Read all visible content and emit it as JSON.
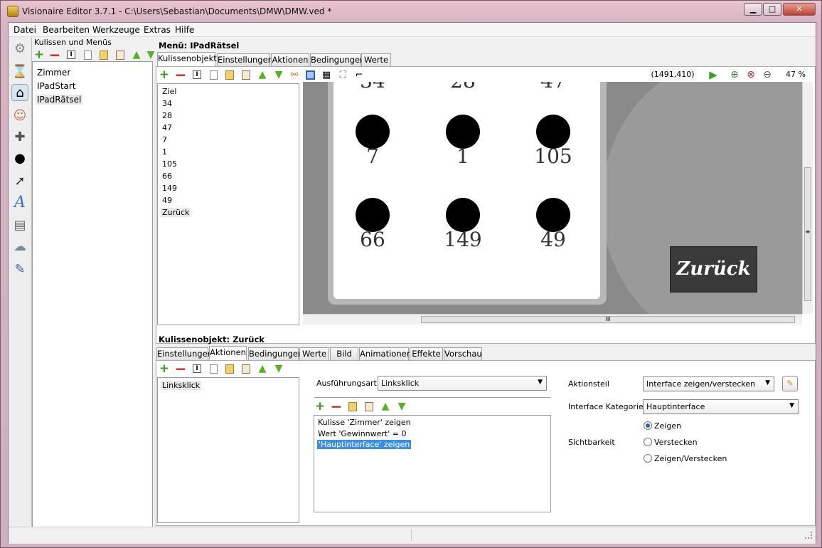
{
  "window": {
    "title": "Visionaire Editor 3.7.1 - C:\\Users\\Sebastian\\Documents\\DMW\\DMW.ved *",
    "minimize": "▁",
    "maximize": "□",
    "close": "✕"
  },
  "menubar": [
    "Datei",
    "Bearbeiten",
    "Werkzeuge",
    "Extras",
    "Hilfe"
  ],
  "left_icons": [
    "gear-icon",
    "hourglass-icon",
    "home-icon",
    "person-icon",
    "gamepad-icon",
    "ball-icon",
    "pointer-icon",
    "font-icon",
    "document-icon",
    "weather-icon",
    "scroll-icon"
  ],
  "scenes": {
    "header": "Kulissen und Menüs",
    "items": [
      "Zimmer",
      "IPadStart",
      "IPadRätsel"
    ],
    "selected": "IPadRätsel"
  },
  "menu": {
    "title": "Menü: IPadRätsel",
    "tabs": [
      "Kulissenobjekte",
      "Einstellungen",
      "Aktionen",
      "Bedingungen",
      "Werte"
    ],
    "objects": [
      "Ziel",
      "34",
      "28",
      "47",
      "7",
      "1",
      "105",
      "66",
      "149",
      "49",
      "Zurück"
    ],
    "selected_object": "Zurück",
    "coords": "(1491,410)",
    "zoom": "47 %"
  },
  "canvas": {
    "top_partial": [
      "34",
      "28",
      "47"
    ],
    "row1": [
      "7",
      "1",
      "105"
    ],
    "row2": [
      "66",
      "149",
      "49"
    ],
    "back_button": "Zurück",
    "scroll_grip": "III",
    "scroll_grip_v": "≡"
  },
  "object": {
    "title": "Kulissenobjekt: Zurück",
    "tabs": [
      "Einstellungen",
      "Aktionen",
      "Bedingungen",
      "Werte",
      "Bild",
      "Animationen",
      "Effekte",
      "Vorschau"
    ],
    "actions": [
      "Linksklick"
    ],
    "ausfuehrungsart_label": "Ausführungsart",
    "ausfuehrungsart_value": "Linksklick",
    "action_parts": [
      "Kulisse 'Zimmer' zeigen",
      "Wert 'Gewinnwert' = 0",
      "'Hauptinterface' zeigen"
    ],
    "aktionsteil_label": "Aktionsteil",
    "aktionsteil_value": "Interface zeigen/verstecken",
    "kategorie_label": "Interface Kategorie",
    "kategorie_value": "Hauptinterface",
    "sichtbarkeit_label": "Sichtbarkeit",
    "visibility_options": [
      "Zeigen",
      "Verstecken",
      "Zeigen/Verstecken"
    ],
    "visibility_selected": "Zeigen"
  },
  "colors": {
    "accent": "#3399ff",
    "selection": "#3a8ee6",
    "canvas_bg": "#8a8a8a",
    "frame": "#d8b3c2"
  }
}
